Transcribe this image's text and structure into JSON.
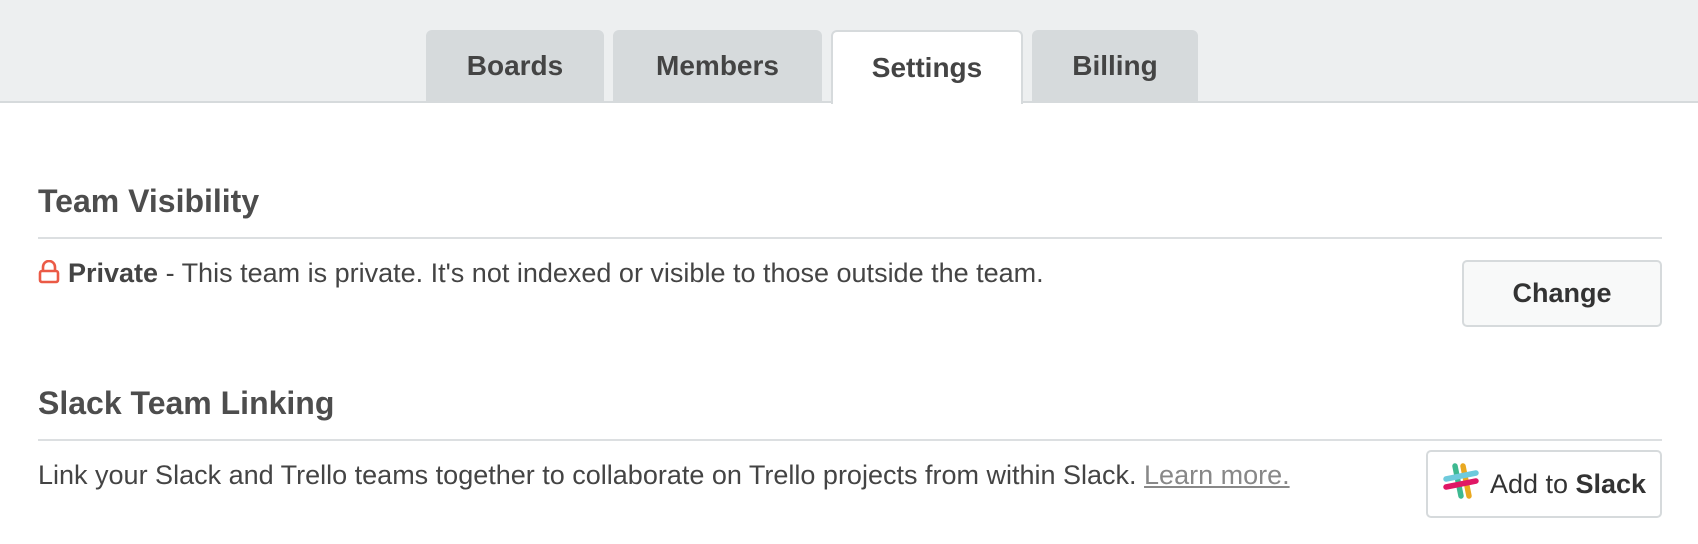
{
  "tabs": [
    {
      "label": "Boards",
      "active": false
    },
    {
      "label": "Members",
      "active": false
    },
    {
      "label": "Settings",
      "active": true
    },
    {
      "label": "Billing",
      "active": false
    }
  ],
  "visibility": {
    "title": "Team Visibility",
    "icon": "lock-icon",
    "icon_color": "#eb5a46",
    "level": "Private",
    "description": " - This team is private. It's not indexed or visible to those outside the team.",
    "change_label": "Change"
  },
  "slack": {
    "title": "Slack Team Linking",
    "description": "Link your Slack and Trello teams together to collaborate on Trello projects from within Slack. ",
    "learn_more": "Learn more.",
    "button_prefix": "Add to ",
    "button_brand": "Slack",
    "icon": "slack-logo-icon"
  },
  "colors": {
    "accent_red": "#eb5a46",
    "tab_bg": "#d6dadc",
    "header_bg": "#edeff0"
  }
}
